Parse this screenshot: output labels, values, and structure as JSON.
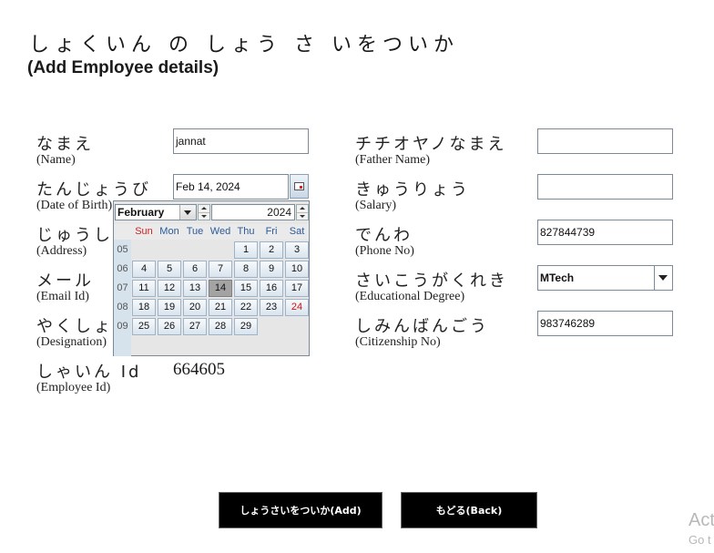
{
  "header": {
    "title_jp": "しょくいん の しょう さ いをついか",
    "title_en": "(Add Employee details)"
  },
  "left_fields": {
    "name": {
      "jp": "なまえ",
      "en": "(Name)",
      "value": "jannat"
    },
    "dob": {
      "jp": "たんじょうび",
      "en": "(Date of Birth)",
      "value": "Feb 14, 2024"
    },
    "address": {
      "jp": "じゅうし",
      "en": "(Address)"
    },
    "email": {
      "jp": "メール",
      "en": "(Email Id)"
    },
    "designation": {
      "jp": "やくしょ",
      "en": "(Designation)"
    },
    "employee_id": {
      "jp": "しゃいん Id",
      "en": "(Employee Id)",
      "value": "664605"
    }
  },
  "right_fields": {
    "father_name": {
      "jp": "チチオヤノなまえ",
      "en": "(Father Name)",
      "value": ""
    },
    "salary": {
      "jp": "きゅうりょう",
      "en": "(Salary)",
      "value": ""
    },
    "phone": {
      "jp": "でんわ",
      "en": "(Phone No)",
      "value": "827844739"
    },
    "education": {
      "jp": "さいこうがくれき",
      "en": "(Educational Degree)",
      "value": "MTech"
    },
    "citizenship": {
      "jp": "しみんばんごう",
      "en": "(Citizenship No)",
      "value": "983746289"
    }
  },
  "calendar": {
    "month": "February",
    "year": "2024",
    "weekdays": [
      "Sun",
      "Mon",
      "Tue",
      "Wed",
      "Thu",
      "Fri",
      "Sat"
    ],
    "week_numbers": [
      "05",
      "06",
      "07",
      "08",
      "09"
    ],
    "weeks": [
      [
        "",
        "",
        "",
        "",
        "1",
        "2",
        "3"
      ],
      [
        "4",
        "5",
        "6",
        "7",
        "8",
        "9",
        "10"
      ],
      [
        "11",
        "12",
        "13",
        "14",
        "15",
        "16",
        "17"
      ],
      [
        "18",
        "19",
        "20",
        "21",
        "22",
        "23",
        "24"
      ],
      [
        "25",
        "26",
        "27",
        "28",
        "29",
        "",
        ""
      ]
    ],
    "selected_day": "14",
    "highlight_day": "24",
    "colors": {
      "sunday_header": "#cc2222",
      "weekday_header": "#2a5a9a",
      "selected_bg": "#a3a3a3"
    }
  },
  "buttons": {
    "add": "しょうさいをついか(Add)",
    "back": "もどる(Back)"
  },
  "watermark": {
    "line1": "Act",
    "line2": "Go t"
  }
}
